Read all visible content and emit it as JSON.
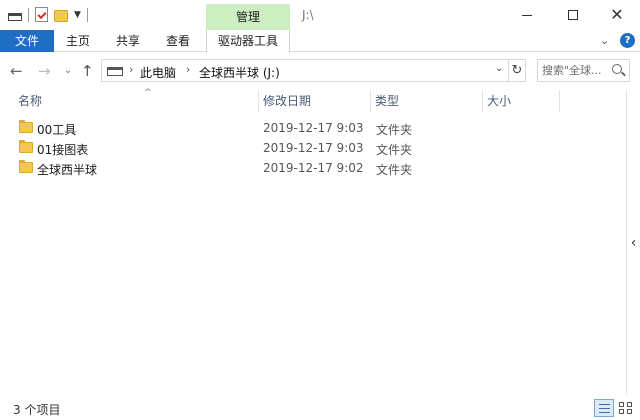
{
  "window": {
    "title": "J:\\",
    "context_tab_header": "管理"
  },
  "ribbon": {
    "tabs": [
      "文件",
      "主页",
      "共享",
      "查看",
      "驱动器工具"
    ]
  },
  "navigation": {
    "breadcrumb": [
      "此电脑",
      "全球西半球 (J:)"
    ],
    "search_placeholder": "搜索\"全球..."
  },
  "columns": [
    "名称",
    "修改日期",
    "类型",
    "大小"
  ],
  "files": [
    {
      "name": "00工具",
      "date": "2019-12-17 9:03",
      "type": "文件夹"
    },
    {
      "name": "01接图表",
      "date": "2019-12-17 9:03",
      "type": "文件夹"
    },
    {
      "name": "全球西半球",
      "date": "2019-12-17 9:02",
      "type": "文件夹"
    }
  ],
  "status": {
    "item_count": "3 个项目"
  },
  "colors": {
    "file_tab": "#1e6fc4",
    "context_tab": "#cdeec0",
    "folder": "#f4c74f",
    "header_text": "#4a5a75"
  }
}
